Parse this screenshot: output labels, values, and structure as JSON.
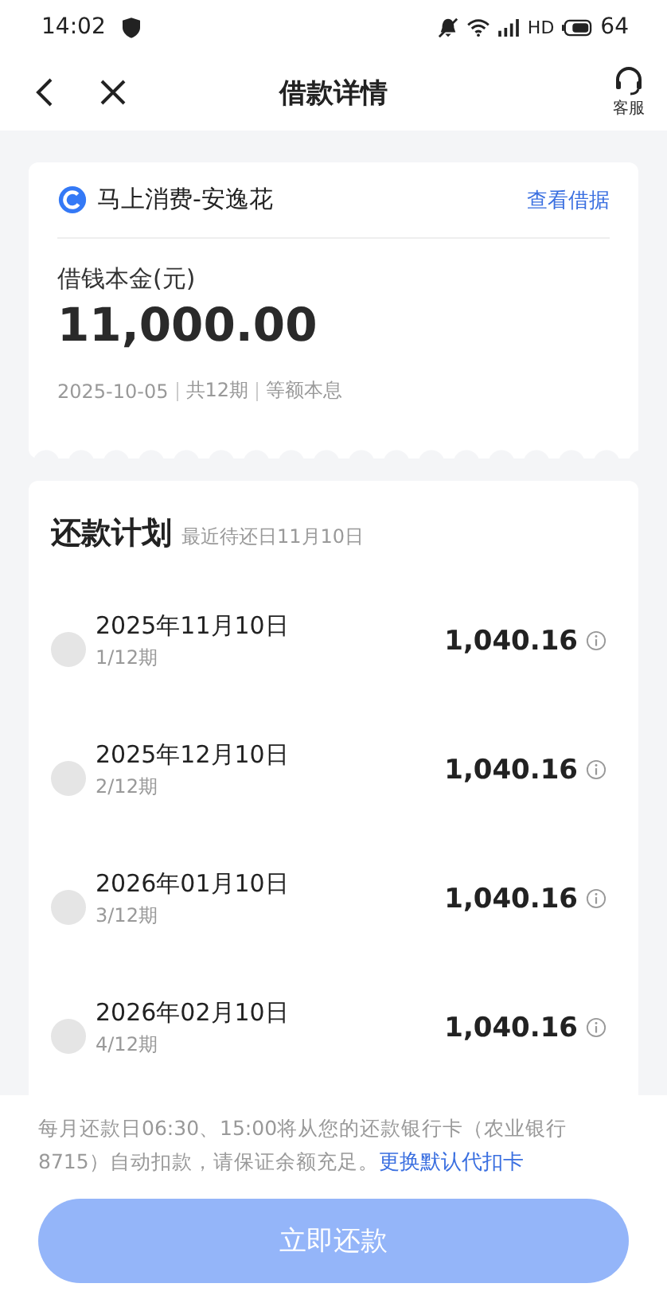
{
  "status_bar": {
    "time": "14:02",
    "network": "HD",
    "battery": "64"
  },
  "nav": {
    "title": "借款详情",
    "service_label": "客服"
  },
  "loan": {
    "lender": "马上消费-安逸花",
    "link": "查看借据",
    "principal_label": "借钱本金(元)",
    "principal": "11,000.00",
    "meta": [
      "2025-10-05",
      "共12期",
      "等额本息"
    ]
  },
  "plan": {
    "title": "还款计划",
    "subtitle": "最近待还日11月10日",
    "installments": [
      {
        "date": "2025年11月10日",
        "period": "1/12期",
        "amount": "1,040.16",
        "paid": false
      },
      {
        "date": "2025年12月10日",
        "period": "2/12期",
        "amount": "1,040.16",
        "paid": false
      },
      {
        "date": "2026年01月10日",
        "period": "3/12期",
        "amount": "1,040.16",
        "paid": false
      },
      {
        "date": "2026年02月10日",
        "period": "4/12期",
        "amount": "1,040.16",
        "paid": false
      }
    ]
  },
  "footer": {
    "notice": "每月还款日06:30、15:00将从您的还款银行卡（农业银行8715）自动扣款，请保证余额充足。",
    "link": "更换默认代扣卡",
    "button": "立即还款"
  }
}
